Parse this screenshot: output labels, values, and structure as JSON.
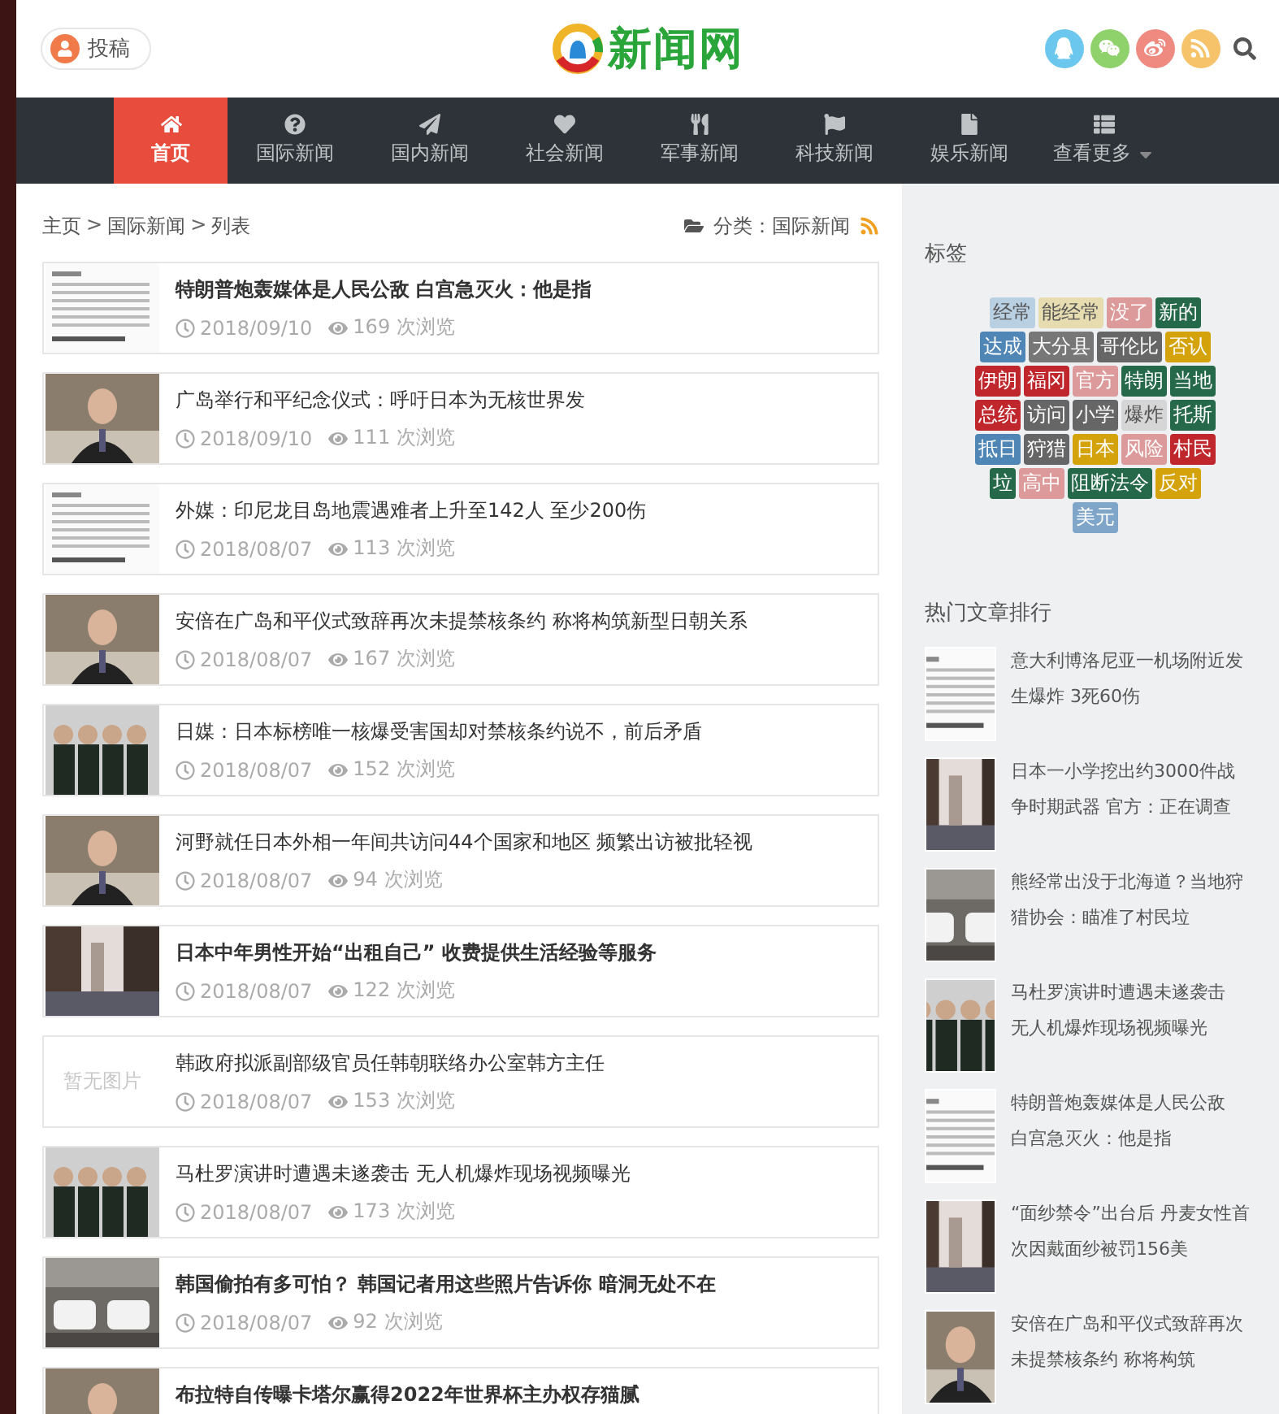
{
  "header": {
    "submit_button": "投稿",
    "logo": "新闻网"
  },
  "nav": [
    {
      "label": "首页",
      "selected": true
    },
    {
      "label": "国际新闻",
      "selected": false
    },
    {
      "label": "国内新闻",
      "selected": false
    },
    {
      "label": "社会新闻",
      "selected": false
    },
    {
      "label": "军事新闻",
      "selected": false
    },
    {
      "label": "科技新闻",
      "selected": false
    },
    {
      "label": "娱乐新闻",
      "selected": false
    },
    {
      "label": "查看更多",
      "selected": false,
      "dropdown": true
    }
  ],
  "breadcrumb": [
    "主页",
    "国际新闻",
    "列表"
  ],
  "breadcrumb_separator": ">",
  "category": "分类：国际新闻",
  "articles": [
    {
      "title": "特朗普炮轰媒体是人民公敌 白宫急灭火：他是指",
      "bold": true,
      "date": "2018/09/10",
      "views": "169 次浏览"
    },
    {
      "title": "广岛举行和平纪念仪式：呼吁日本为无核世界发",
      "bold": false,
      "date": "2018/09/10",
      "views": "111 次浏览"
    },
    {
      "title": "外媒：印尼龙目岛地震遇难者上升至142人 至少200伤",
      "bold": false,
      "date": "2018/08/07",
      "views": "113 次浏览"
    },
    {
      "title": "安倍在广岛和平仪式致辞再次未提禁核条约 称将构筑新型日朝关系",
      "bold": false,
      "date": "2018/08/07",
      "views": "167 次浏览"
    },
    {
      "title": "日媒：日本标榜唯一核爆受害国却对禁核条约说不，前后矛盾",
      "bold": false,
      "date": "2018/08/07",
      "views": "152 次浏览"
    },
    {
      "title": "河野就任日本外相一年间共访问44个国家和地区 频繁出访被批轻视",
      "bold": false,
      "date": "2018/08/07",
      "views": "94 次浏览"
    },
    {
      "title": "日本中年男性开始“出租自己” 收费提供生活经验等服务",
      "bold": true,
      "date": "2018/08/07",
      "views": "122 次浏览"
    },
    {
      "title": "韩政府拟派副部级官员任韩朝联络办公室韩方主任",
      "bold": false,
      "date": "2018/08/07",
      "views": "153 次浏览",
      "no_image": "暂无图片"
    },
    {
      "title": "马杜罗演讲时遭遇未遂袭击 无人机爆炸现场视频曝光",
      "bold": false,
      "date": "2018/08/07",
      "views": "173 次浏览"
    },
    {
      "title": "韩国偷拍有多可怕？ 韩国记者用这些照片告诉你 暗洞无处不在",
      "bold": true,
      "date": "2018/08/07",
      "views": "92 次浏览"
    },
    {
      "title": "布拉特自传曝卡塔尔赢得2022年世界杯主办权存猫腻",
      "bold": true
    }
  ],
  "tags_title": "标签",
  "tags": [
    {
      "label": "经常",
      "color": "#b9cfe2",
      "faded": true
    },
    {
      "label": "能经常",
      "color": "#e6dcb0",
      "faded": true
    },
    {
      "label": "没了",
      "color": "#dd9a9a",
      "faded": false
    },
    {
      "label": "新的",
      "color": "#25694a",
      "faded": false
    },
    {
      "label": "达成",
      "color": "#4f86b5",
      "faded": false
    },
    {
      "label": "大分县",
      "color": "#777777",
      "faded": false
    },
    {
      "label": "哥伦比",
      "color": "#666666",
      "faded": false
    },
    {
      "label": "否认",
      "color": "#d4a20a",
      "faded": false
    },
    {
      "label": "伊朗",
      "color": "#c0272d",
      "faded": false
    },
    {
      "label": "福冈",
      "color": "#c0272d",
      "faded": false
    },
    {
      "label": "官方",
      "color": "#dd9a9a",
      "faded": false
    },
    {
      "label": "特朗",
      "color": "#25694a",
      "faded": false
    },
    {
      "label": "当地",
      "color": "#25694a",
      "faded": false
    },
    {
      "label": "总统",
      "color": "#c0272d",
      "faded": false
    },
    {
      "label": "访问",
      "color": "#666666",
      "faded": false
    },
    {
      "label": "小学",
      "color": "#666666",
      "faded": false
    },
    {
      "label": "爆炸",
      "color": "#d6d6d6",
      "faded": true
    },
    {
      "label": "托斯",
      "color": "#25694a",
      "faded": false
    },
    {
      "label": "抵日",
      "color": "#4f86b5",
      "faded": false
    },
    {
      "label": "狩猎",
      "color": "#666666",
      "faded": false
    },
    {
      "label": "日本",
      "color": "#d4a20a",
      "faded": false
    },
    {
      "label": "风险",
      "color": "#dd9a9a",
      "faded": false
    },
    {
      "label": "村民",
      "color": "#c0272d",
      "faded": false
    },
    {
      "label": "垃",
      "color": "#25694a",
      "faded": false
    },
    {
      "label": "高中",
      "color": "#dd9a9a",
      "faded": false
    },
    {
      "label": "阻断法令",
      "color": "#25694a",
      "faded": false
    },
    {
      "label": "反对",
      "color": "#d4a20a",
      "faded": false
    },
    {
      "label": "美元",
      "color": "#7fa6c9",
      "faded": false
    }
  ],
  "hot_title": "热门文章排行",
  "hot": [
    {
      "lines": [
        "意大利博洛尼亚一机场附近发",
        "生爆炸 3死60伤"
      ]
    },
    {
      "lines": [
        "日本一小学挖出约3000件战",
        "争时期武器 官方：正在调查"
      ]
    },
    {
      "lines": [
        "熊经常出没于北海道？当地狩",
        "猎协会：瞄准了村民垃"
      ]
    },
    {
      "lines": [
        "马杜罗演讲时遭遇未遂袭击",
        "无人机爆炸现场视频曝光"
      ]
    },
    {
      "lines": [
        "特朗普炮轰媒体是人民公敌",
        "白宫急灭火：他是指"
      ]
    },
    {
      "lines": [
        "“面纱禁令”出台后 丹麦女性首",
        "次因戴面纱被罚156美"
      ]
    },
    {
      "lines": [
        "安倍在广岛和平仪式致辞再次",
        "未提禁核条约 称将构筑"
      ]
    }
  ]
}
